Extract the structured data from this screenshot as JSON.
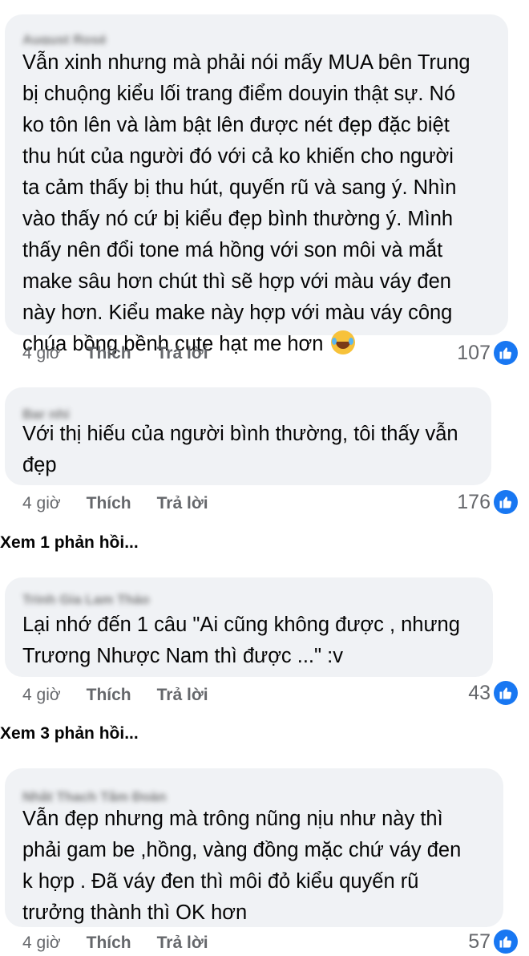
{
  "comments": [
    {
      "author": "August Rosé",
      "text": "Vẫn xinh nhưng mà phải nói mấy MUA bên Trung\nbị chuộng kiểu lối trang điểm douyin thật sự. Nó\nko tôn lên và làm bật lên được nét đẹp đặc biệt\nthu hút của người đó với cả ko khiến cho người\nta cảm thấy bị thu hút, quyến rũ và sang ý. Nhìn\nvào thấy nó cứ bị kiểu đẹp bình thường ý. Mình\nthấy nên đổi tone má hồng với son môi và  mắt\nmake sâu hơn chút thì sẽ hợp với màu váy đen\nnày hơn. Kiểu make này hợp với màu váy công\nchúa bồng bềnh cute hạt me hơn",
      "time": "4 giờ",
      "like_label": "Thích",
      "reply_label": "Trả lời",
      "like_count": "107"
    },
    {
      "author": "Bar nhi",
      "text": "Với thị hiếu của người bình thường, tôi thấy vẫn\nđẹp",
      "time": "4 giờ",
      "like_label": "Thích",
      "reply_label": "Trả lời",
      "like_count": "176",
      "view_replies": "Xem 1 phản hồi..."
    },
    {
      "author": "Trinh Gia Lam Thảo",
      "text": "Lại nhớ đến 1 câu \"Ai cũng không được , nhưng\nTrương Nhược Nam thì được ...\" :v",
      "time": "4 giờ",
      "like_label": "Thích",
      "reply_label": "Trả lời",
      "like_count": "43",
      "view_replies": "Xem 3 phản hồi..."
    },
    {
      "author": "Nhật Thạch Tâm Đoàn",
      "text": "Vẫn đẹp nhưng mà trông nũng nịu như này thì\nphải gam be ,hồng, vàng đồng mặc chứ váy đen\nk hợp . Đã váy đen thì môi đỏ kiểu quyến rũ\ntrưởng thành thì OK hơn",
      "time": "4 giờ",
      "like_label": "Thích",
      "reply_label": "Trả lời",
      "like_count": "57"
    }
  ],
  "icons": {
    "like": "thumbs-up-icon",
    "emoji": "laughing-tears-emoji-icon"
  },
  "colors": {
    "bubble": "#f0f2f5",
    "like_badge": "#1877f2",
    "meta_text": "#65676b"
  }
}
